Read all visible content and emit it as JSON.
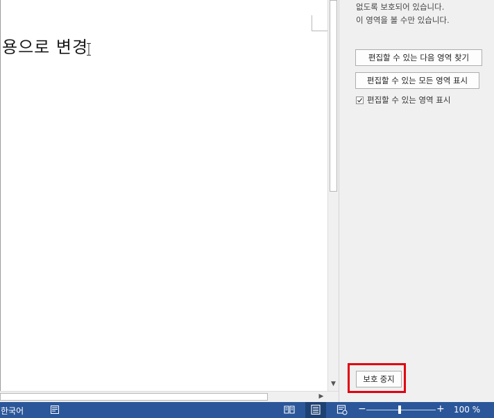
{
  "document": {
    "visible_text": "용으로 변경"
  },
  "panel": {
    "line1": "없도록 보호되어 있습니다.",
    "line2": "이 영역을 볼 수만 있습니다.",
    "find_next_button": "편집할 수 있는 다음 영역 찾기",
    "show_all_button": "편집할 수 있는 모든 영역 표시",
    "highlight_checkbox_label": "편집할 수 있는 영역 표시",
    "highlight_checked": true,
    "stop_protection_button": "보호 중지"
  },
  "status_bar": {
    "language": "한국어",
    "zoom_level": "100 %",
    "zoom_percent": 100
  },
  "colors": {
    "status_bar": "#2b579a",
    "highlight_box": "#e0000f"
  }
}
